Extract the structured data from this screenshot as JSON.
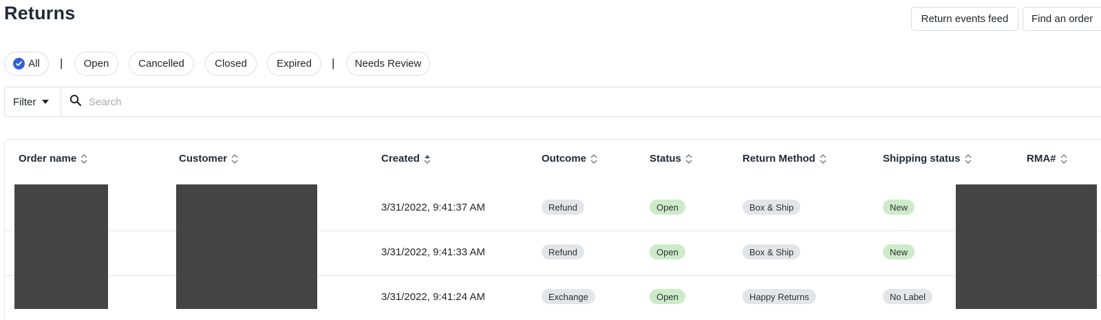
{
  "page": {
    "title": "Returns"
  },
  "header": {
    "events_feed_label": "Return events feed",
    "find_order_label": "Find an order"
  },
  "filters": {
    "all_label": "All",
    "separator": "|",
    "pills": [
      "Open",
      "Cancelled",
      "Closed",
      "Expired"
    ],
    "needs_review_label": "Needs Review"
  },
  "search": {
    "filter_label": "Filter",
    "placeholder": "Search"
  },
  "table": {
    "columns": [
      "Order name",
      "Customer",
      "Created",
      "Outcome",
      "Status",
      "Return Method",
      "Shipping status",
      "RMA#"
    ],
    "rows": [
      {
        "created": "3/31/2022, 9:41:37 AM",
        "outcome": "Refund",
        "status": "Open",
        "return_method": "Box & Ship",
        "shipping_status": "New"
      },
      {
        "created": "3/31/2022, 9:41:33 AM",
        "outcome": "Refund",
        "status": "Open",
        "return_method": "Box & Ship",
        "shipping_status": "New"
      },
      {
        "created": "3/31/2022, 9:41:24 AM",
        "outcome": "Exchange",
        "status": "Open",
        "return_method": "Happy Returns",
        "shipping_status": "No Label"
      }
    ]
  },
  "colors": {
    "accent": "#2f5fde",
    "badge_gray": "#e3e5e8",
    "badge_green": "#cdebc8",
    "redaction": "#444444"
  }
}
